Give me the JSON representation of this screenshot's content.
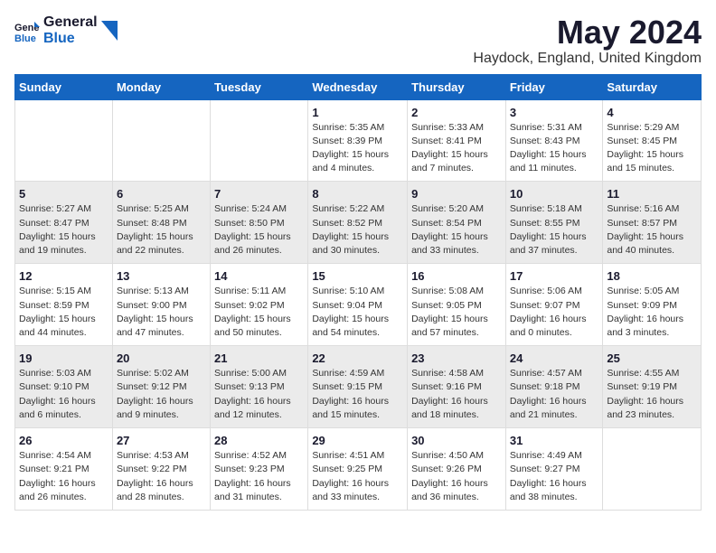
{
  "logo": {
    "general": "General",
    "blue": "Blue"
  },
  "title": "May 2024",
  "location": "Haydock, England, United Kingdom",
  "weekdays": [
    "Sunday",
    "Monday",
    "Tuesday",
    "Wednesday",
    "Thursday",
    "Friday",
    "Saturday"
  ],
  "weeks": [
    [
      {
        "day": "",
        "info": ""
      },
      {
        "day": "",
        "info": ""
      },
      {
        "day": "",
        "info": ""
      },
      {
        "day": "1",
        "info": "Sunrise: 5:35 AM\nSunset: 8:39 PM\nDaylight: 15 hours\nand 4 minutes."
      },
      {
        "day": "2",
        "info": "Sunrise: 5:33 AM\nSunset: 8:41 PM\nDaylight: 15 hours\nand 7 minutes."
      },
      {
        "day": "3",
        "info": "Sunrise: 5:31 AM\nSunset: 8:43 PM\nDaylight: 15 hours\nand 11 minutes."
      },
      {
        "day": "4",
        "info": "Sunrise: 5:29 AM\nSunset: 8:45 PM\nDaylight: 15 hours\nand 15 minutes."
      }
    ],
    [
      {
        "day": "5",
        "info": "Sunrise: 5:27 AM\nSunset: 8:47 PM\nDaylight: 15 hours\nand 19 minutes."
      },
      {
        "day": "6",
        "info": "Sunrise: 5:25 AM\nSunset: 8:48 PM\nDaylight: 15 hours\nand 22 minutes."
      },
      {
        "day": "7",
        "info": "Sunrise: 5:24 AM\nSunset: 8:50 PM\nDaylight: 15 hours\nand 26 minutes."
      },
      {
        "day": "8",
        "info": "Sunrise: 5:22 AM\nSunset: 8:52 PM\nDaylight: 15 hours\nand 30 minutes."
      },
      {
        "day": "9",
        "info": "Sunrise: 5:20 AM\nSunset: 8:54 PM\nDaylight: 15 hours\nand 33 minutes."
      },
      {
        "day": "10",
        "info": "Sunrise: 5:18 AM\nSunset: 8:55 PM\nDaylight: 15 hours\nand 37 minutes."
      },
      {
        "day": "11",
        "info": "Sunrise: 5:16 AM\nSunset: 8:57 PM\nDaylight: 15 hours\nand 40 minutes."
      }
    ],
    [
      {
        "day": "12",
        "info": "Sunrise: 5:15 AM\nSunset: 8:59 PM\nDaylight: 15 hours\nand 44 minutes."
      },
      {
        "day": "13",
        "info": "Sunrise: 5:13 AM\nSunset: 9:00 PM\nDaylight: 15 hours\nand 47 minutes."
      },
      {
        "day": "14",
        "info": "Sunrise: 5:11 AM\nSunset: 9:02 PM\nDaylight: 15 hours\nand 50 minutes."
      },
      {
        "day": "15",
        "info": "Sunrise: 5:10 AM\nSunset: 9:04 PM\nDaylight: 15 hours\nand 54 minutes."
      },
      {
        "day": "16",
        "info": "Sunrise: 5:08 AM\nSunset: 9:05 PM\nDaylight: 15 hours\nand 57 minutes."
      },
      {
        "day": "17",
        "info": "Sunrise: 5:06 AM\nSunset: 9:07 PM\nDaylight: 16 hours\nand 0 minutes."
      },
      {
        "day": "18",
        "info": "Sunrise: 5:05 AM\nSunset: 9:09 PM\nDaylight: 16 hours\nand 3 minutes."
      }
    ],
    [
      {
        "day": "19",
        "info": "Sunrise: 5:03 AM\nSunset: 9:10 PM\nDaylight: 16 hours\nand 6 minutes."
      },
      {
        "day": "20",
        "info": "Sunrise: 5:02 AM\nSunset: 9:12 PM\nDaylight: 16 hours\nand 9 minutes."
      },
      {
        "day": "21",
        "info": "Sunrise: 5:00 AM\nSunset: 9:13 PM\nDaylight: 16 hours\nand 12 minutes."
      },
      {
        "day": "22",
        "info": "Sunrise: 4:59 AM\nSunset: 9:15 PM\nDaylight: 16 hours\nand 15 minutes."
      },
      {
        "day": "23",
        "info": "Sunrise: 4:58 AM\nSunset: 9:16 PM\nDaylight: 16 hours\nand 18 minutes."
      },
      {
        "day": "24",
        "info": "Sunrise: 4:57 AM\nSunset: 9:18 PM\nDaylight: 16 hours\nand 21 minutes."
      },
      {
        "day": "25",
        "info": "Sunrise: 4:55 AM\nSunset: 9:19 PM\nDaylight: 16 hours\nand 23 minutes."
      }
    ],
    [
      {
        "day": "26",
        "info": "Sunrise: 4:54 AM\nSunset: 9:21 PM\nDaylight: 16 hours\nand 26 minutes."
      },
      {
        "day": "27",
        "info": "Sunrise: 4:53 AM\nSunset: 9:22 PM\nDaylight: 16 hours\nand 28 minutes."
      },
      {
        "day": "28",
        "info": "Sunrise: 4:52 AM\nSunset: 9:23 PM\nDaylight: 16 hours\nand 31 minutes."
      },
      {
        "day": "29",
        "info": "Sunrise: 4:51 AM\nSunset: 9:25 PM\nDaylight: 16 hours\nand 33 minutes."
      },
      {
        "day": "30",
        "info": "Sunrise: 4:50 AM\nSunset: 9:26 PM\nDaylight: 16 hours\nand 36 minutes."
      },
      {
        "day": "31",
        "info": "Sunrise: 4:49 AM\nSunset: 9:27 PM\nDaylight: 16 hours\nand 38 minutes."
      },
      {
        "day": "",
        "info": ""
      }
    ]
  ]
}
